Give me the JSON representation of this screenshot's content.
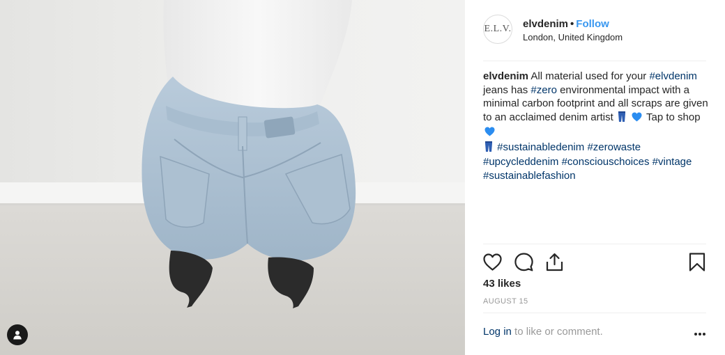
{
  "post": {
    "username": "elvdenim",
    "follow_label": "Follow",
    "separator": "•",
    "location": "London, United Kingdom",
    "avatar_text": "E.L.V.",
    "caption": {
      "username": "elvdenim",
      "p1": "All material used for your",
      "tag_elvdenim": "#elvdenim",
      "p2": "jeans has",
      "tag_zero": "#zero",
      "p3": "environmental impact with a minimal carbon footprint and all scraps are given to an acclaimed denim artist",
      "p4": "Tap to shop",
      "tags": [
        "#sustainabledenim",
        "#zerowaste",
        "#upcycleddenim",
        "#consciouschoices",
        "#vintage",
        "#sustainablefashion"
      ]
    },
    "likes": "43 likes",
    "date": "AUGUST 15",
    "footer": {
      "login_label": "Log in",
      "rest": "to like or comment."
    },
    "icons": {
      "like": "heart-icon",
      "comment": "comment-icon",
      "share": "share-icon",
      "save": "bookmark-icon",
      "more": "more-icon",
      "user_tags": "user-icon"
    },
    "colors": {
      "link": "#3897f0",
      "hashtag": "#003569",
      "muted": "#999999",
      "heart_emoji": "#2b8df0"
    }
  }
}
